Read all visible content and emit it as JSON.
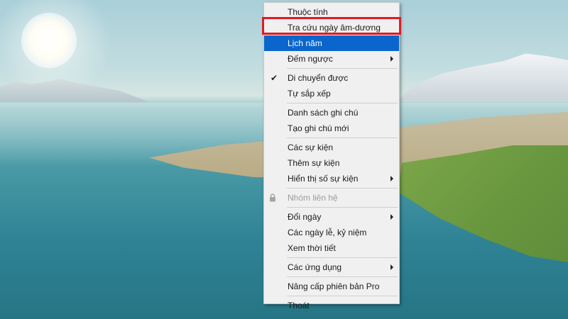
{
  "menu": {
    "items": [
      {
        "label": "Thuộc tính"
      },
      {
        "label": "Tra cứu ngày âm-dương"
      },
      {
        "label": "Lịch năm"
      },
      {
        "label": "Đếm ngược"
      },
      {
        "label": "Di chuyển được",
        "checked": true
      },
      {
        "label": "Tự sắp xếp"
      },
      {
        "label": "Danh sách ghi chú"
      },
      {
        "label": "Tạo ghi chú mới"
      },
      {
        "label": "Các sự kiện"
      },
      {
        "label": "Thêm sự kiện"
      },
      {
        "label": "Hiển thị số sự kiện"
      },
      {
        "label": "Nhóm liên hệ",
        "disabled": true,
        "icon": "lock-icon"
      },
      {
        "label": "Đổi ngày"
      },
      {
        "label": "Các ngày lễ, kỷ niệm"
      },
      {
        "label": "Xem thời tiết"
      },
      {
        "label": "Các ứng dụng"
      },
      {
        "label": "Nâng cấp phiên bản Pro"
      },
      {
        "label": "Thoát"
      }
    ],
    "highlighted_item": "Lịch năm",
    "annotated_item": "Tra cứu ngày âm-dương"
  },
  "colors": {
    "menu_bg": "#f0f0f0",
    "highlight": "#0a66cc",
    "annotation_border": "#e01b24",
    "disabled_text": "#9c9c9c"
  }
}
